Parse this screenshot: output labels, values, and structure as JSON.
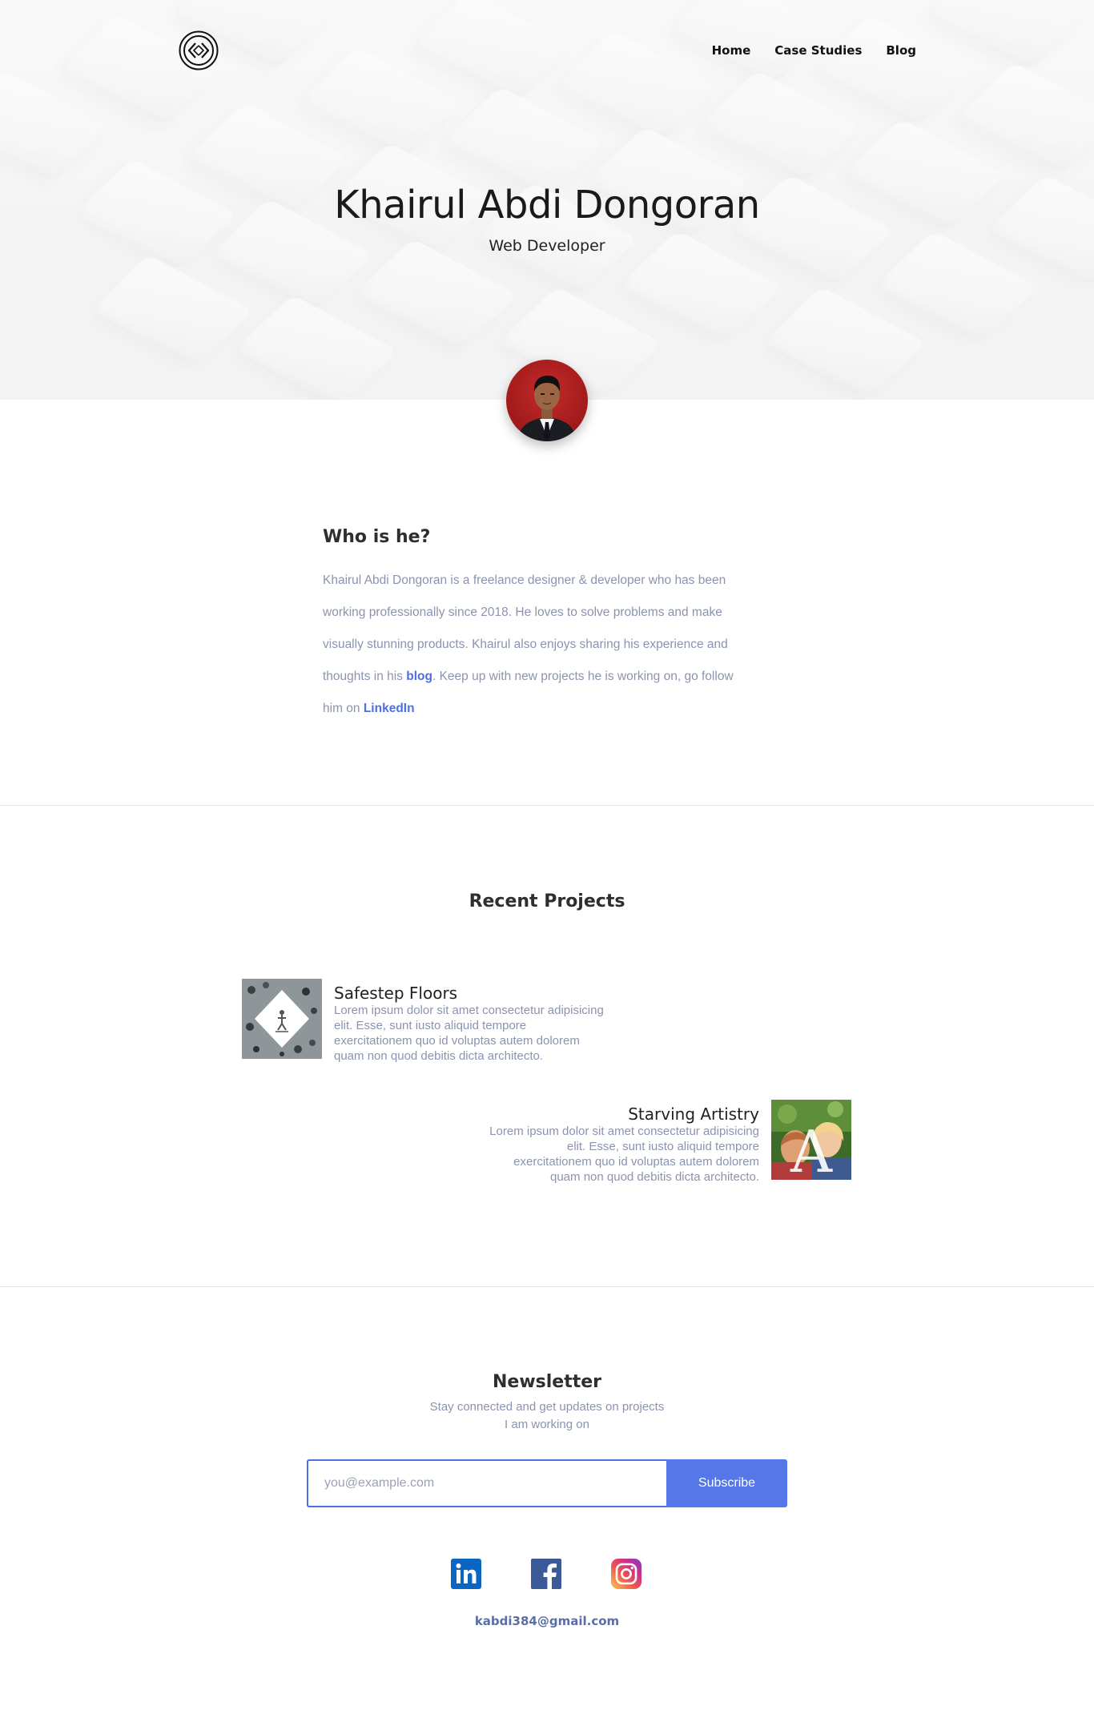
{
  "nav": {
    "items": [
      {
        "label": "Home"
      },
      {
        "label": "Case Studies"
      },
      {
        "label": "Blog"
      }
    ]
  },
  "hero": {
    "name": "Khairul Abdi Dongoran",
    "role": "Web Developer"
  },
  "about": {
    "heading": "Who is he?",
    "text_1": "Khairul Abdi Dongoran is a freelance designer & developer who has been working professionally since 2018. He loves to solve problems and make visually stunning products. Khairul also enjoys sharing his experience and thoughts in his ",
    "blog_link": "blog",
    "text_2": ". Keep up with new projects he is working on, go follow him on ",
    "linkedin_link": "LinkedIn"
  },
  "projects": {
    "heading": "Recent Projects",
    "items": [
      {
        "title": "Safestep Floors",
        "description": "Lorem ipsum dolor sit amet consectetur adipisicing elit. Esse, sunt iusto aliquid tempore exercitationem quo id voluptas autem dolorem quam non quod debitis dicta architecto."
      },
      {
        "title": "Starving Artistry",
        "description": "Lorem ipsum dolor sit amet consectetur adipisicing elit. Esse, sunt iusto aliquid tempore exercitationem quo id voluptas autem dolorem quam non quod debitis dicta architecto."
      }
    ]
  },
  "newsletter": {
    "heading": "Newsletter",
    "subtitle": "Stay connected and get updates on projects I am working on",
    "placeholder": "you@example.com",
    "button_label": "Subscribe"
  },
  "socials": [
    {
      "icon": "linkedin-icon",
      "color": "#0a66c2"
    },
    {
      "icon": "facebook-icon",
      "color": "#3b5998"
    },
    {
      "icon": "instagram-icon",
      "color": "#e1306c"
    }
  ],
  "contact": {
    "email": "kabdi384@gmail.com"
  },
  "colors": {
    "accent": "#4d6fe0",
    "button": "#5577e8",
    "muted_text": "#8b93b0"
  }
}
